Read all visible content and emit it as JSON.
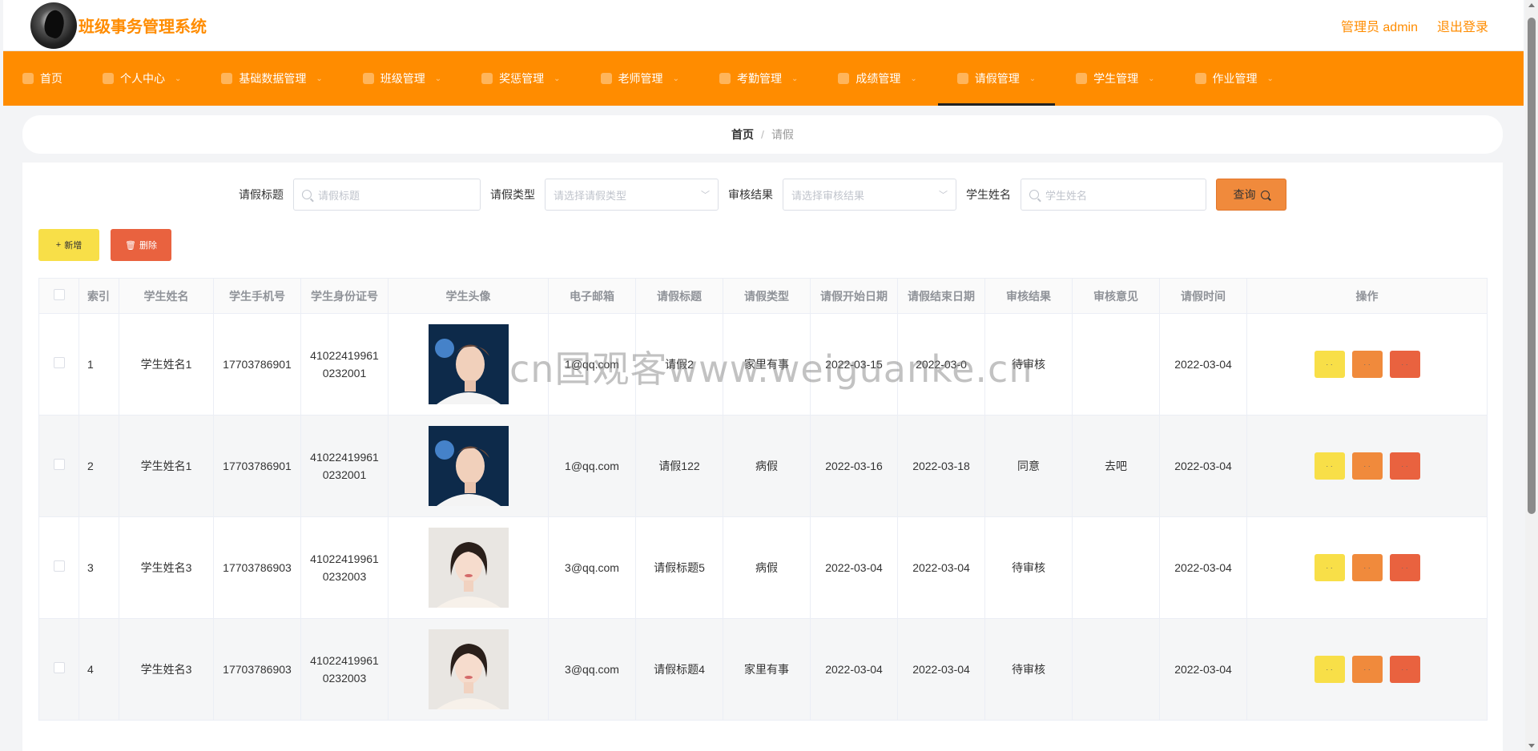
{
  "header": {
    "title": "班级事务管理系统",
    "user_label": "管理员 admin",
    "logout_label": "退出登录"
  },
  "nav": {
    "items": [
      {
        "label": "首页",
        "icon": "home-icon"
      },
      {
        "label": "个人中心",
        "icon": "user-icon"
      },
      {
        "label": "基础数据管理",
        "icon": "gauge-icon"
      },
      {
        "label": "班级管理",
        "icon": "school-icon"
      },
      {
        "label": "奖惩管理",
        "icon": "award-icon"
      },
      {
        "label": "老师管理",
        "icon": "clock-icon"
      },
      {
        "label": "考勤管理",
        "icon": "calendar-icon"
      },
      {
        "label": "成绩管理",
        "icon": "chart-icon"
      },
      {
        "label": "请假管理",
        "icon": "document-icon"
      },
      {
        "label": "学生管理",
        "icon": "target-icon"
      },
      {
        "label": "作业管理",
        "icon": "bar-chart-icon"
      }
    ],
    "active_index": 8
  },
  "breadcrumb": {
    "home": "首页",
    "separator": "/",
    "current": "请假"
  },
  "search": {
    "title_label": "请假标题",
    "title_placeholder": "请假标题",
    "type_label": "请假类型",
    "type_placeholder": "请选择请假类型",
    "result_label": "审核结果",
    "result_placeholder": "请选择审核结果",
    "name_label": "学生姓名",
    "name_placeholder": "学生姓名",
    "query_label": "查询"
  },
  "toolbar": {
    "add_label": "新增",
    "delete_label": "删除"
  },
  "table": {
    "headers": [
      "索引",
      "学生姓名",
      "学生手机号",
      "学生身份证号",
      "学生头像",
      "电子邮箱",
      "请假标题",
      "请假类型",
      "请假开始日期",
      "请假结束日期",
      "审核结果",
      "审核意见",
      "请假时间",
      "操作"
    ],
    "rows": [
      {
        "index": "1",
        "name": "学生姓名1",
        "phone": "17703786901",
        "id_card": "410224199610232001",
        "email": "1@qq.com",
        "title": "请假2",
        "type": "家里有事",
        "start": "2022-03-15",
        "end": "2022-03-0",
        "result": "待审核",
        "opinion": "",
        "time": "2022-03-04",
        "avatar": "male"
      },
      {
        "index": "2",
        "name": "学生姓名1",
        "phone": "17703786901",
        "id_card": "410224199610232001",
        "email": "1@qq.com",
        "title": "请假122",
        "type": "病假",
        "start": "2022-03-16",
        "end": "2022-03-18",
        "result": "同意",
        "opinion": "去吧",
        "time": "2022-03-04",
        "avatar": "male"
      },
      {
        "index": "3",
        "name": "学生姓名3",
        "phone": "17703786903",
        "id_card": "410224199610232003",
        "email": "3@qq.com",
        "title": "请假标题5",
        "type": "病假",
        "start": "2022-03-04",
        "end": "2022-03-04",
        "result": "待审核",
        "opinion": "",
        "time": "2022-03-04",
        "avatar": "female"
      },
      {
        "index": "4",
        "name": "学生姓名3",
        "phone": "17703786903",
        "id_card": "410224199610232003",
        "email": "3@qq.com",
        "title": "请假标题4",
        "type": "家里有事",
        "start": "2022-03-04",
        "end": "2022-03-04",
        "result": "待审核",
        "opinion": "",
        "time": "2022-03-04",
        "avatar": "female"
      }
    ],
    "op_labels": [
      "· ·",
      "· ·",
      "· ·"
    ]
  },
  "watermark": "cn国观客www.weiguanke.cn",
  "colors": {
    "accent": "#ff8c00",
    "warning": "#f8df48",
    "orange": "#f08a3c",
    "danger": "#e9623f"
  }
}
